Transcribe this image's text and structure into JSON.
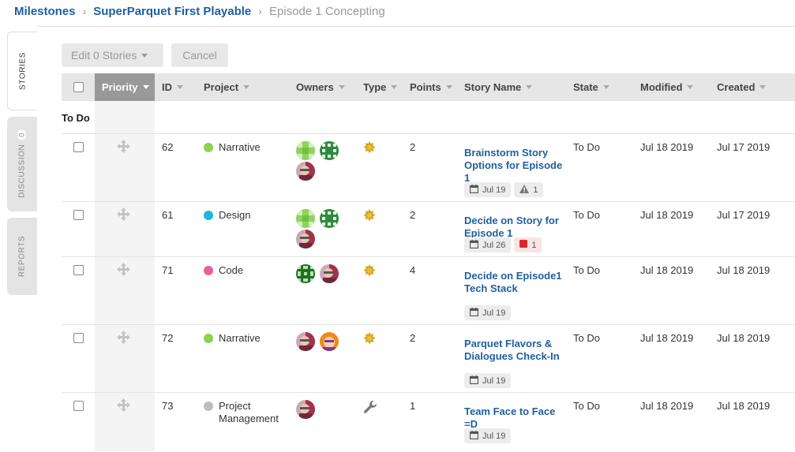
{
  "breadcrumb": {
    "items": [
      "Milestones",
      "SuperParquet First Playable"
    ],
    "current": "Episode 1 Concepting"
  },
  "side_tabs": [
    {
      "label": "STORIES",
      "active": true
    },
    {
      "label": "DISCUSSION",
      "badge": "0"
    },
    {
      "label": "REPORTS"
    }
  ],
  "toolbar": {
    "edit_label": "Edit 0 Stories",
    "cancel_label": "Cancel"
  },
  "columns": [
    "Priority",
    "ID",
    "Project",
    "Owners",
    "Type",
    "Points",
    "Story Name",
    "State",
    "Modified",
    "Created"
  ],
  "sorted_column": "Priority",
  "group": "To Do",
  "project_colors": {
    "Narrative": "#8ed155",
    "Design": "#1fb6e0",
    "Code": "#e8609a",
    "Project Management": "#bdbdbd"
  },
  "rows": [
    {
      "id": "62",
      "project": "Narrative",
      "type_icon": "feature-icon",
      "points": "2",
      "story": "Brainstorm Story Options for Episode 1",
      "state": "To Do",
      "modified": "Jul 18 2019",
      "created": "Jul 17 2019",
      "due": "Jul 19",
      "extra_tag": "1",
      "extra_tag_icon": "warning-icon"
    },
    {
      "id": "61",
      "project": "Design",
      "type_icon": "feature-icon",
      "points": "2",
      "story": "Decide on Story for Episode 1",
      "state": "To Do",
      "modified": "Jul 18 2019",
      "created": "Jul 17 2019",
      "due": "Jul 26",
      "extra_tag": "1",
      "extra_tag_icon": "blocker-icon"
    },
    {
      "id": "71",
      "project": "Code",
      "type_icon": "feature-icon",
      "points": "4",
      "story": "Decide on Episode1 Tech Stack",
      "state": "To Do",
      "modified": "Jul 18 2019",
      "created": "Jul 18 2019",
      "due": "Jul 19"
    },
    {
      "id": "72",
      "project": "Narrative",
      "type_icon": "feature-icon",
      "points": "2",
      "story": "Parquet Flavors & Dialogues Check-In",
      "state": "To Do",
      "modified": "Jul 18 2019",
      "created": "Jul 18 2019",
      "due": "Jul 19"
    },
    {
      "id": "73",
      "project": "Project Management",
      "type_icon": "wrench-icon",
      "points": "1",
      "story": "Team Face to Face =D",
      "state": "To Do",
      "modified": "Jul 18 2019",
      "created": "Jul 18 2019",
      "due": "Jul 19"
    }
  ]
}
